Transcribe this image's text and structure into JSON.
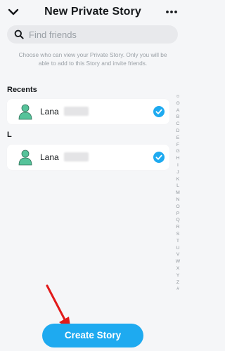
{
  "header": {
    "title": "New Private Story"
  },
  "search": {
    "placeholder": "Find friends",
    "value": ""
  },
  "info": "Choose who can view your Private Story. Only you will be able to add to this Story and invite friends.",
  "sections": [
    {
      "label": "Recents",
      "friend": {
        "name": "Lana",
        "selected": true
      }
    },
    {
      "label": "L",
      "friend": {
        "name": "Lana",
        "selected": true
      }
    }
  ],
  "index": [
    "☺",
    "⊙",
    "A",
    "B",
    "C",
    "D",
    "E",
    "F",
    "G",
    "H",
    "I",
    "J",
    "K",
    "L",
    "M",
    "N",
    "O",
    "P",
    "Q",
    "R",
    "S",
    "T",
    "U",
    "V",
    "W",
    "X",
    "Y",
    "Z",
    "#"
  ],
  "create_button": {
    "label": "Create Story"
  },
  "colors": {
    "accent": "#1eaaf0",
    "avatar": "#56c39a",
    "arrow": "#e21b1b"
  },
  "icons": [
    "chevron-down-icon",
    "more-icon",
    "search-icon",
    "avatar-icon",
    "checkmark-icon",
    "arrow-annotation"
  ]
}
